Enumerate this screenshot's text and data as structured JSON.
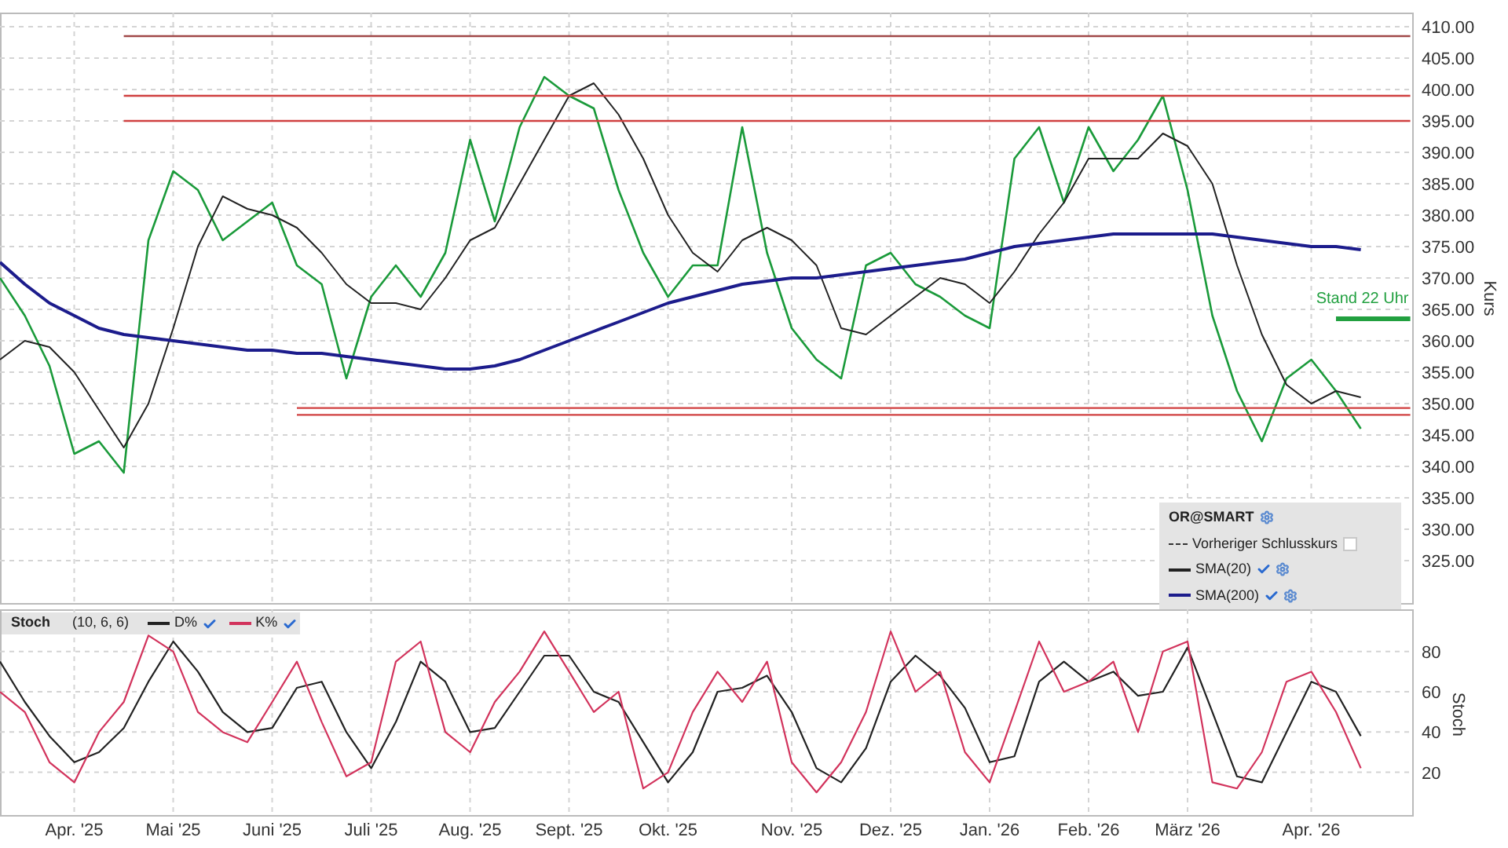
{
  "price_panel": {
    "legend": {
      "title": "OR@SMART",
      "items": [
        {
          "label": "Vorheriger Schlusskurs",
          "kind": "dashed",
          "checked": false
        },
        {
          "kind": "solid",
          "checked": true
        },
        {
          "kind": "solid",
          "checked": true
        }
      ]
    },
    "chart_data": {
      "type": "line",
      "ylabel": "Kurs",
      "ylim": [
        318,
        412.25
      ],
      "grid": true,
      "categories": [
        null,
        null,
        null,
        null,
        null,
        null,
        null,
        null,
        null,
        null,
        null,
        null,
        null,
        null,
        null,
        null,
        null,
        null,
        null,
        null,
        null,
        null,
        null,
        null,
        null,
        null,
        null,
        null,
        null,
        null,
        null,
        null,
        null,
        null,
        null,
        null,
        null,
        null,
        null,
        null,
        null,
        null,
        null,
        null,
        null,
        null,
        null,
        null,
        null,
        null,
        null,
        null,
        null,
        null,
        null,
        null,
        null,
        null
      ],
      "yticks": [
        {
          "value": 325,
          "label": "325.00"
        },
        {
          "value": 330,
          "label": "330.00"
        },
        {
          "value": 335,
          "label": "335.00"
        },
        {
          "value": 340,
          "label": "340.00"
        },
        {
          "value": 345,
          "label": "345.00"
        },
        {
          "value": 350,
          "label": "350.00"
        },
        {
          "value": 355,
          "label": "355.00"
        },
        {
          "value": 360,
          "label": "360.00"
        },
        {
          "value": 365,
          "label": "365.00"
        },
        {
          "value": 370,
          "label": "370.00"
        },
        {
          "value": 375,
          "label": "375.00"
        },
        {
          "value": 380,
          "label": "380.00"
        },
        {
          "value": 385,
          "label": "385.00"
        },
        {
          "value": 390,
          "label": "390.00"
        },
        {
          "value": 395,
          "label": "395.00"
        },
        {
          "value": 400,
          "label": "400.00"
        },
        {
          "value": 405,
          "label": "405.00"
        },
        {
          "value": 410,
          "label": "410.00"
        }
      ],
      "series": [
        {
          "color": "#1a9a3a",
          "values": [
            370,
            364,
            356,
            342,
            344,
            339,
            376,
            387,
            384,
            376,
            379,
            382,
            372,
            369,
            354,
            367,
            372,
            367,
            374,
            392,
            379,
            394,
            402,
            399,
            397,
            384,
            374,
            367,
            372,
            372,
            394,
            374,
            362,
            357,
            354,
            372,
            374,
            369,
            367,
            364,
            362,
            389,
            394,
            382,
            394,
            387,
            392,
            399,
            384,
            364,
            352,
            344,
            354,
            357,
            352,
            346,
            null,
            null
          ]
        },
        {
          "name": "SMA(20)",
          "color": "#222222",
          "values": [
            357,
            360,
            359,
            355,
            349,
            343,
            350,
            362,
            375,
            383,
            381,
            380,
            378,
            374,
            369,
            366,
            366,
            365,
            370,
            376,
            378,
            385,
            392,
            399,
            401,
            396,
            389,
            380,
            374,
            371,
            376,
            378,
            376,
            372,
            362,
            361,
            364,
            367,
            370,
            369,
            366,
            371,
            377,
            382,
            389,
            389,
            389,
            393,
            391,
            385,
            372,
            361,
            353,
            350,
            352,
            351,
            null,
            null
          ]
        },
        {
          "name": "SMA(200)",
          "color": "#1c1c8c",
          "values": [
            372.5,
            369,
            366,
            364,
            362,
            361,
            360.5,
            360,
            359.5,
            359,
            358.5,
            358.5,
            358,
            358,
            357.5,
            357,
            356.5,
            356,
            355.5,
            355.5,
            356,
            357,
            358.5,
            360,
            361.5,
            363,
            364.5,
            366,
            367,
            368,
            369,
            369.5,
            370,
            370,
            370.5,
            371,
            371.5,
            372,
            372.5,
            373,
            374,
            375,
            375.5,
            376,
            376.5,
            377,
            377,
            377,
            377,
            377,
            376.5,
            376,
            375.5,
            375,
            375,
            374.5,
            null,
            null
          ]
        },
        {
          "color": "#a04848",
          "values": [
            null,
            null,
            null,
            null,
            null,
            408.5,
            408.5,
            408.5,
            408.5,
            408.5,
            408.5,
            408.5,
            408.5,
            408.5,
            408.5,
            408.5,
            408.5,
            408.5,
            408.5,
            408.5,
            408.5,
            408.5,
            408.5,
            408.5,
            408.5,
            408.5,
            408.5,
            408.5,
            408.5,
            408.5,
            408.5,
            408.5,
            408.5,
            408.5,
            408.5,
            408.5,
            408.5,
            408.5,
            408.5,
            408.5,
            408.5,
            408.5,
            408.5,
            408.5,
            408.5,
            408.5,
            408.5,
            408.5,
            408.5,
            408.5,
            408.5,
            408.5,
            408.5,
            408.5,
            408.5,
            408.5,
            408.5,
            408.5
          ]
        },
        {
          "color": "#d04040",
          "values": [
            null,
            null,
            null,
            null,
            null,
            399,
            399,
            399,
            399,
            399,
            399,
            399,
            399,
            399,
            399,
            399,
            399,
            399,
            399,
            399,
            399,
            399,
            399,
            399,
            399,
            399,
            399,
            399,
            399,
            399,
            399,
            399,
            399,
            399,
            399,
            399,
            399,
            399,
            399,
            399,
            399,
            399,
            399,
            399,
            399,
            399,
            399,
            399,
            399,
            399,
            399,
            399,
            399,
            399,
            399,
            399,
            399,
            399
          ]
        },
        {
          "color": "#d04040",
          "values": [
            null,
            null,
            null,
            null,
            null,
            395,
            395,
            395,
            395,
            395,
            395,
            395,
            395,
            395,
            395,
            395,
            395,
            395,
            395,
            395,
            395,
            395,
            395,
            395,
            395,
            395,
            395,
            395,
            395,
            395,
            395,
            395,
            395,
            395,
            395,
            395,
            395,
            395,
            395,
            395,
            395,
            395,
            395,
            395,
            395,
            395,
            395,
            395,
            395,
            395,
            395,
            395,
            395,
            395,
            395,
            395,
            395,
            395
          ]
        },
        {
          "color": "#d04040",
          "values": [
            null,
            null,
            null,
            null,
            null,
            null,
            null,
            null,
            null,
            null,
            null,
            null,
            349.3,
            349.3,
            349.3,
            349.3,
            349.3,
            349.3,
            349.3,
            349.3,
            349.3,
            349.3,
            349.3,
            349.3,
            349.3,
            349.3,
            349.3,
            349.3,
            349.3,
            349.3,
            349.3,
            349.3,
            349.3,
            349.3,
            349.3,
            349.3,
            349.3,
            349.3,
            349.3,
            349.3,
            349.3,
            349.3,
            349.3,
            349.3,
            349.3,
            349.3,
            349.3,
            349.3,
            349.3,
            349.3,
            349.3,
            349.3,
            349.3,
            349.3,
            349.3,
            349.3,
            349.3,
            349.3
          ]
        },
        {
          "color": "#d04040",
          "values": [
            null,
            null,
            null,
            null,
            null,
            null,
            null,
            null,
            null,
            null,
            null,
            null,
            348.2,
            348.2,
            348.2,
            348.2,
            348.2,
            348.2,
            348.2,
            348.2,
            348.2,
            348.2,
            348.2,
            348.2,
            348.2,
            348.2,
            348.2,
            348.2,
            348.2,
            348.2,
            348.2,
            348.2,
            348.2,
            348.2,
            348.2,
            348.2,
            348.2,
            348.2,
            348.2,
            348.2,
            348.2,
            348.2,
            348.2,
            348.2,
            348.2,
            348.2,
            348.2,
            348.2,
            348.2,
            348.2,
            348.2,
            348.2,
            348.2,
            348.2,
            348.2,
            348.2,
            348.2,
            348.2
          ]
        },
        {
          "name": "Stand 22 Uhr",
          "color": "#22a040",
          "values": [
            null,
            null,
            null,
            null,
            null,
            null,
            null,
            null,
            null,
            null,
            null,
            null,
            null,
            null,
            null,
            null,
            null,
            null,
            null,
            null,
            null,
            null,
            null,
            null,
            null,
            null,
            null,
            null,
            null,
            null,
            null,
            null,
            null,
            null,
            null,
            null,
            null,
            null,
            null,
            null,
            null,
            null,
            null,
            null,
            null,
            null,
            null,
            null,
            null,
            null,
            null,
            null,
            null,
            null,
            363.5,
            363.5,
            363.5,
            363.5
          ]
        }
      ]
    }
  },
  "stoch_panel": {
    "legend": {
      "title": "Stoch",
      "params": "(10, 6, 6)",
      "items": [
        {
          "checked": true
        },
        {
          "checked": true
        }
      ]
    },
    "chart_data": {
      "type": "line",
      "ylabel": "Stoch",
      "ylim": [
        -2,
        101
      ],
      "grid": true,
      "categories": [
        null,
        null,
        null,
        "Apr. '25",
        null,
        null,
        null,
        "Mai '25",
        null,
        null,
        null,
        "Juni '25",
        null,
        null,
        null,
        "Juli '25",
        null,
        null,
        null,
        "Aug. '25",
        null,
        null,
        null,
        "Sept. '25",
        null,
        null,
        null,
        "Okt. '25",
        null,
        null,
        null,
        null,
        "Nov. '25",
        null,
        null,
        null,
        "Dez. '25",
        null,
        null,
        null,
        "Jan. '26",
        null,
        null,
        null,
        "Feb. '26",
        null,
        null,
        null,
        "März '26",
        null,
        null,
        null,
        null,
        "Apr. '26",
        null,
        null
      ],
      "yticks": [
        20,
        40,
        60,
        80
      ],
      "series": [
        {
          "name": "D%",
          "color": "#222222",
          "values": [
            75,
            55,
            38,
            25,
            30,
            42,
            65,
            85,
            70,
            50,
            40,
            42,
            62,
            65,
            40,
            22,
            45,
            75,
            65,
            40,
            42,
            60,
            78,
            78,
            60,
            55,
            35,
            15,
            30,
            60,
            62,
            68,
            50,
            22,
            15,
            32,
            65,
            78,
            68,
            52,
            25,
            28,
            65,
            75,
            65,
            70,
            58,
            60,
            82,
            50,
            18,
            15,
            40,
            65,
            60,
            38
          ]
        },
        {
          "name": "K%",
          "color": "#d2335c",
          "values": [
            60,
            50,
            25,
            15,
            40,
            55,
            88,
            80,
            50,
            40,
            35,
            55,
            75,
            45,
            18,
            25,
            75,
            85,
            40,
            30,
            55,
            70,
            90,
            70,
            50,
            60,
            12,
            20,
            50,
            70,
            55,
            75,
            25,
            10,
            25,
            50,
            90,
            60,
            70,
            30,
            15,
            50,
            85,
            60,
            65,
            75,
            40,
            80,
            85,
            15,
            12,
            30,
            65,
            70,
            50,
            22
          ]
        }
      ]
    }
  }
}
